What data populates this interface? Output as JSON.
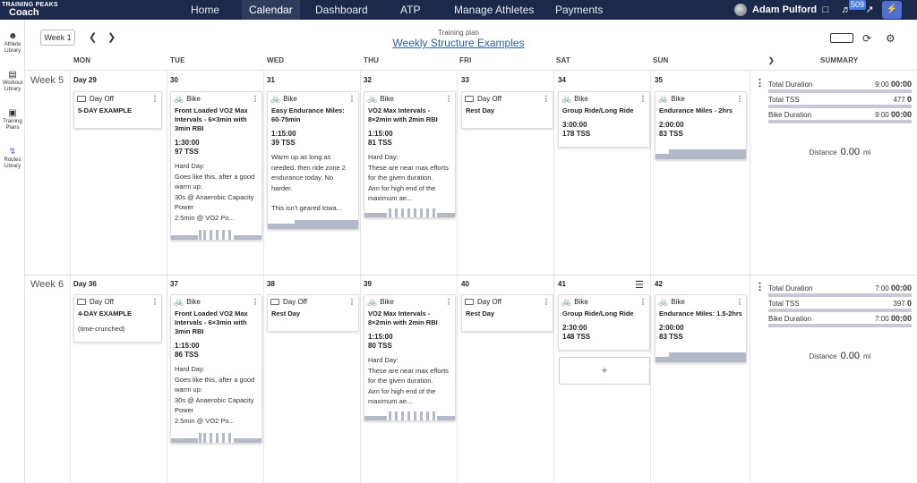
{
  "topbar": {
    "logo_top": "TRAINING PEAKS",
    "logo_bottom": "Coach",
    "nav": [
      "Home",
      "Calendar",
      "Dashboard",
      "ATP",
      "Manage Athletes",
      "Payments"
    ],
    "active_nav": "Calendar",
    "user_name": "Adam Pulford",
    "notification_count": "509"
  },
  "sidebar": [
    {
      "label": "Athlete Library",
      "icon": "athlete-icon"
    },
    {
      "label": "Workout Library",
      "icon": "workout-library-icon"
    },
    {
      "label": "Training Plans",
      "icon": "training-plans-icon"
    },
    {
      "label": "Routes Library",
      "icon": "routes-icon"
    }
  ],
  "toolbar": {
    "week_button": "Week 1",
    "plan_label": "Training plan",
    "plan_title": "Weekly Structure Examples"
  },
  "headers": [
    "MON",
    "TUE",
    "WED",
    "THU",
    "FRI",
    "SAT",
    "SUN"
  ],
  "summary_header": "SUMMARY",
  "weeks": [
    {
      "label": "Week 5",
      "days": [
        "Day 29",
        "30",
        "31",
        "32",
        "33",
        "34",
        "35"
      ],
      "summary": {
        "total_duration_label": "Total Duration",
        "total_duration_planned": "9:00",
        "total_duration_done": "00:00",
        "total_tss_label": "Total TSS",
        "total_tss_planned": "477",
        "total_tss_done": "0",
        "bike_duration_label": "Bike Duration",
        "bike_duration_planned": "9:00",
        "bike_duration_done": "00:00",
        "distance_label": "Distance",
        "distance_value": "0.00",
        "distance_unit": "mi"
      }
    },
    {
      "label": "Week 6",
      "days": [
        "Day 36",
        "37",
        "38",
        "39",
        "40",
        "41",
        "42"
      ],
      "summary": {
        "total_duration_label": "Total Duration",
        "total_duration_planned": "7:00",
        "total_duration_done": "00:00",
        "total_tss_label": "Total TSS",
        "total_tss_planned": "397",
        "total_tss_done": "0",
        "bike_duration_label": "Bike Duration",
        "bike_duration_planned": "7:00",
        "bike_duration_done": "00:00",
        "distance_label": "Distance",
        "distance_value": "0.00",
        "distance_unit": "mi"
      }
    }
  ],
  "cards": {
    "w5mon": {
      "type": "Day Off",
      "title": "5-DAY EXAMPLE"
    },
    "w5tue": {
      "type": "Bike",
      "title": "Front Loaded VO2 Max Intervals - 6×3min with 3min RBI",
      "duration": "1:30:00",
      "tss": "97 TSS",
      "desc": [
        "Hard Day:",
        "Goes like this, after a good warm up:",
        "30s @ Anaerobic Capacity Power",
        "2.5min @ VO2 Po..."
      ]
    },
    "w5wed": {
      "type": "Bike",
      "title": "Easy Endurance Miles: 60-75min",
      "duration": "1:15:00",
      "tss": "39 TSS",
      "desc": [
        "Warm up as long as needed, then ride zone 2 endurance today. No harder.",
        "",
        "This isn't geared towa..."
      ]
    },
    "w5thu": {
      "type": "Bike",
      "title": "VO2 Max Intervals - 8×2min with 2min RBI",
      "duration": "1:15:00",
      "tss": "81 TSS",
      "desc": [
        "Hard Day:",
        "These are near max efforts for the given duration.",
        "Aim for high end of the maximum ae..."
      ]
    },
    "w5fri": {
      "type": "Day Off",
      "title": "Rest Day"
    },
    "w5sat": {
      "type": "Bike",
      "title": "Group Ride/Long Ride",
      "duration": "3:00:00",
      "tss": "178 TSS"
    },
    "w5sun": {
      "type": "Bike",
      "title": "Endurance Miles - 2hrs",
      "duration": "2:00:00",
      "tss": "83 TSS"
    },
    "w6mon": {
      "type": "Day Off",
      "title": "4-DAY EXAMPLE",
      "desc": [
        "(time-crunched)"
      ]
    },
    "w6tue": {
      "type": "Bike",
      "title": "Front Loaded VO2 Max Intervals - 6×3min with 3min RBI",
      "duration": "1:15:00",
      "tss": "86 TSS",
      "desc": [
        "Hard Day:",
        "Goes like this, after a good warm up:",
        "30s @ Anaerobic Capacity Power",
        "2.5min @ VO2 Po..."
      ]
    },
    "w6wed": {
      "type": "Day Off",
      "title": "Rest Day"
    },
    "w6thu": {
      "type": "Bike",
      "title": "VO2 Max Intervals - 8×2min with 2min RBI",
      "duration": "1:15:00",
      "tss": "80 TSS",
      "desc": [
        "Hard Day:",
        "These are near max efforts for the given duration.",
        "Aim for high end of the maximum ae..."
      ]
    },
    "w6fri": {
      "type": "Day Off",
      "title": "Rest Day"
    },
    "w6sat": {
      "type": "Bike",
      "title": "Group Ride/Long Ride",
      "duration": "2:30:00",
      "tss": "148 TSS"
    },
    "w6sun": {
      "type": "Bike",
      "title": "Endurance Miles: 1.5-2hrs",
      "duration": "2:00:00",
      "tss": "83 TSS"
    }
  },
  "add_workout": "+",
  "colors": {
    "topbar": "#1b2a4a",
    "link": "#2a5db0",
    "bike": "#8e44c8",
    "graph": "#b4b9c8"
  }
}
